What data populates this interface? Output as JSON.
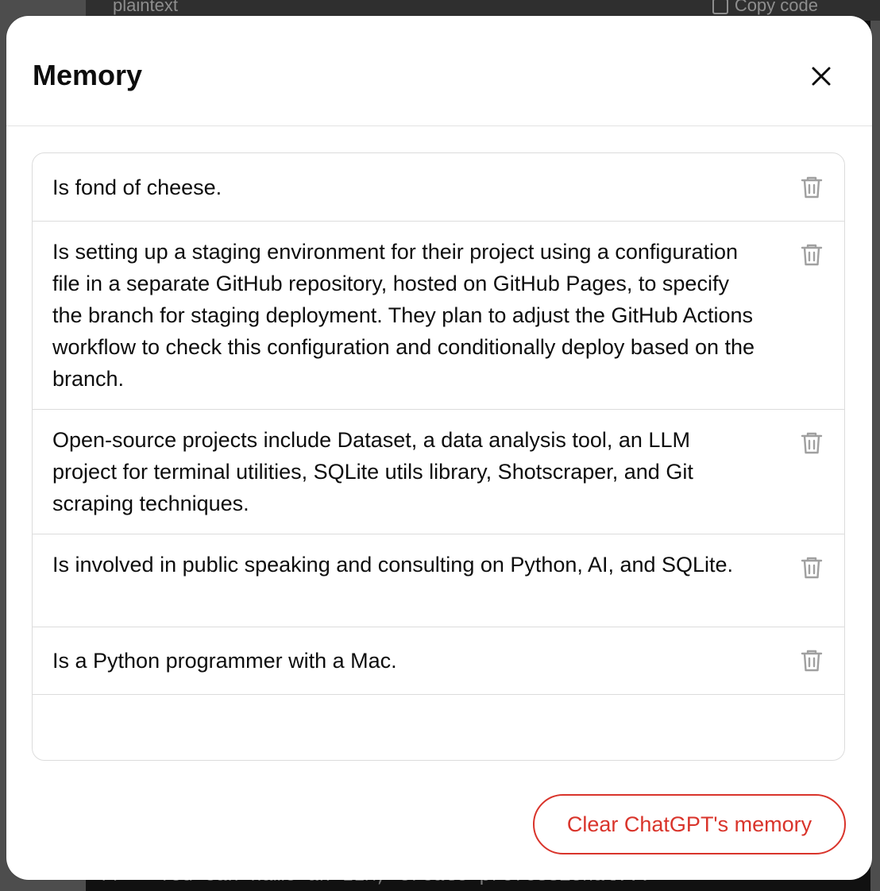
{
  "background": {
    "code_language": "plaintext",
    "copy_label": "Copy code",
    "code_line": "//   You can name an LLM, create professional..."
  },
  "modal": {
    "title": "Memory",
    "close_icon": "close-icon",
    "memories": [
      {
        "text": "Is fond of cheese.",
        "icon": "trash-icon"
      },
      {
        "text": "Is setting up a staging environment for their project using a configuration file in a separate GitHub repository, hosted on GitHub Pages, to specify the branch for staging deployment. They plan to adjust the GitHub Actions workflow to check this configuration and conditionally deploy based on the branch.",
        "icon": "trash-icon"
      },
      {
        "text": "Open-source projects include Dataset, a data analysis tool, an LLM project for terminal utilities, SQLite utils library, Shotscraper, and Git scraping techniques.",
        "icon": "trash-icon"
      },
      {
        "text": "Is involved in public speaking and consulting on Python, AI, and SQLite.",
        "icon": "trash-icon"
      },
      {
        "text": "Is a Python programmer with a Mac.",
        "icon": "trash-icon"
      }
    ],
    "clear_button_label": "Clear ChatGPT's memory"
  },
  "colors": {
    "danger": "#d9342b",
    "text": "#0d0d0d",
    "icon_gray": "#a0a0a0",
    "border": "#dcdcdc"
  }
}
